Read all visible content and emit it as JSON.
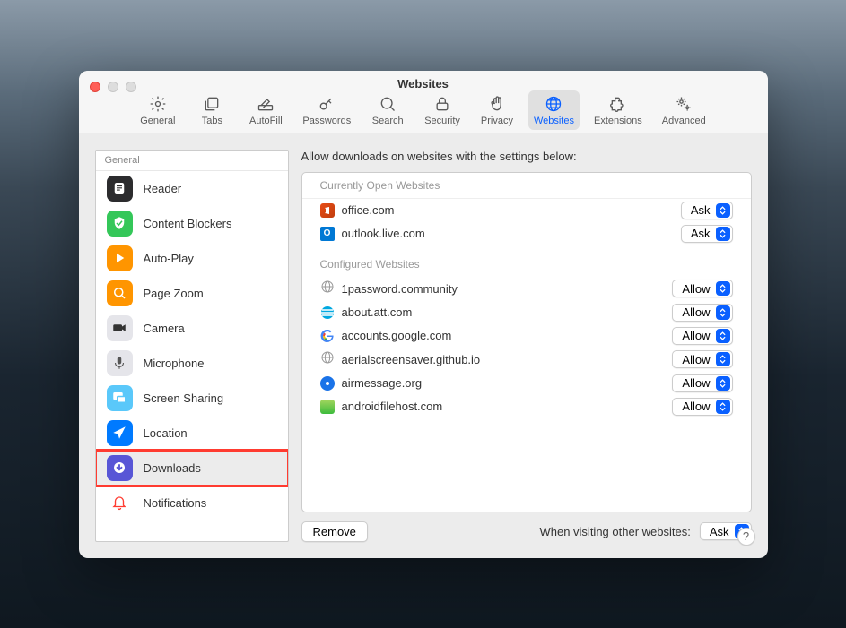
{
  "window_title": "Websites",
  "toolbar": [
    {
      "id": "general",
      "label": "General",
      "icon": "gear-icon"
    },
    {
      "id": "tabs",
      "label": "Tabs",
      "icon": "tabs-icon"
    },
    {
      "id": "autofill",
      "label": "AutoFill",
      "icon": "pencil-icon"
    },
    {
      "id": "passwords",
      "label": "Passwords",
      "icon": "key-icon"
    },
    {
      "id": "search",
      "label": "Search",
      "icon": "magnify-icon"
    },
    {
      "id": "security",
      "label": "Security",
      "icon": "lock-icon"
    },
    {
      "id": "privacy",
      "label": "Privacy",
      "icon": "hand-icon"
    },
    {
      "id": "websites",
      "label": "Websites",
      "icon": "globe-icon",
      "selected": true
    },
    {
      "id": "extensions",
      "label": "Extensions",
      "icon": "puzzle-icon"
    },
    {
      "id": "advanced",
      "label": "Advanced",
      "icon": "gears-icon"
    }
  ],
  "sidebar_header": "General",
  "sidebar": [
    {
      "id": "reader",
      "label": "Reader",
      "color": "#2c2c2e",
      "icon": "reader-icon"
    },
    {
      "id": "content-blockers",
      "label": "Content Blockers",
      "color": "#34c759",
      "icon": "shield-check-icon"
    },
    {
      "id": "auto-play",
      "label": "Auto-Play",
      "color": "#ff9500",
      "icon": "play-icon"
    },
    {
      "id": "page-zoom",
      "label": "Page Zoom",
      "color": "#ff9500",
      "icon": "zoom-icon"
    },
    {
      "id": "camera",
      "label": "Camera",
      "color": "#e5e5ea",
      "icon": "camera-icon",
      "iconcolor": "#333"
    },
    {
      "id": "microphone",
      "label": "Microphone",
      "color": "#e5e5ea",
      "icon": "microphone-icon",
      "iconcolor": "#555"
    },
    {
      "id": "screen-sharing",
      "label": "Screen Sharing",
      "color": "#5ac8fa",
      "icon": "screens-icon"
    },
    {
      "id": "location",
      "label": "Location",
      "color": "#007aff",
      "icon": "arrow-icon"
    },
    {
      "id": "downloads",
      "label": "Downloads",
      "color": "#5856d6",
      "icon": "download-arrow-icon",
      "highlighted": true
    },
    {
      "id": "notifications",
      "label": "Notifications",
      "color": "#ffffff",
      "icon": "bell-icon",
      "iconcolor": "#ff3b30"
    }
  ],
  "heading": "Allow downloads on websites with the settings below:",
  "open_header": "Currently Open Websites",
  "open_sites": [
    {
      "name": "office.com",
      "value": "Ask",
      "favicon": "office"
    },
    {
      "name": "outlook.live.com",
      "value": "Ask",
      "favicon": "outlook"
    }
  ],
  "configured_header": "Configured Websites",
  "configured_sites": [
    {
      "name": "1password.community",
      "value": "Allow",
      "favicon": "globe"
    },
    {
      "name": "about.att.com",
      "value": "Allow",
      "favicon": "att"
    },
    {
      "name": "accounts.google.com",
      "value": "Allow",
      "favicon": "google"
    },
    {
      "name": "aerialscreensaver.github.io",
      "value": "Allow",
      "favicon": "globe"
    },
    {
      "name": "airmessage.org",
      "value": "Allow",
      "favicon": "airm"
    },
    {
      "name": "androidfilehost.com",
      "value": "Allow",
      "favicon": "afh"
    }
  ],
  "remove_button": "Remove",
  "default_label": "When visiting other websites:",
  "default_value": "Ask",
  "help": "?"
}
